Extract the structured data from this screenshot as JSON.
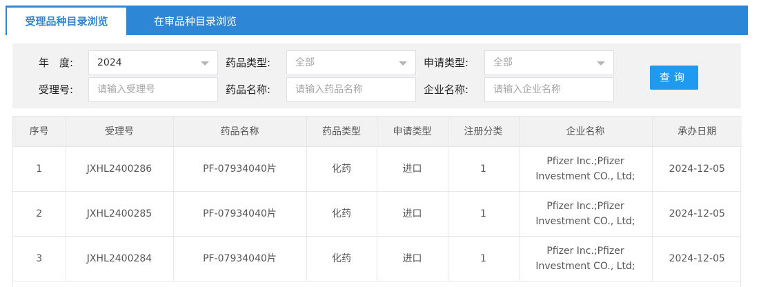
{
  "tabs": [
    {
      "label": "受理品种目录浏览",
      "active": true
    },
    {
      "label": "在审品种目录浏览",
      "active": false
    }
  ],
  "filters": {
    "year": {
      "label": "年　度:",
      "value": "2024"
    },
    "drug_type": {
      "label": "药品类型:",
      "value": "全部"
    },
    "apply_type": {
      "label": "申请类型:",
      "value": "全部"
    },
    "accept_no": {
      "label": "受理号:",
      "placeholder": "请输入受理号"
    },
    "drug_name": {
      "label": "药品名称:",
      "placeholder": "请输入药品名称"
    },
    "company_name": {
      "label": "企业名称:",
      "placeholder": "请输入企业名称"
    },
    "query_button": "查询"
  },
  "table": {
    "headers": [
      "序号",
      "受理号",
      "药品名称",
      "药品类型",
      "申请类型",
      "注册分类",
      "企业名称",
      "承办日期"
    ],
    "rows": [
      [
        "1",
        "JXHL2400286",
        "PF-07934040片",
        "化药",
        "进口",
        "1",
        "Pfizer Inc.;Pfizer Investment CO., Ltd;",
        "2024-12-05"
      ],
      [
        "2",
        "JXHL2400285",
        "PF-07934040片",
        "化药",
        "进口",
        "1",
        "Pfizer Inc.;Pfizer Investment CO., Ltd;",
        "2024-12-05"
      ],
      [
        "3",
        "JXHL2400284",
        "PF-07934040片",
        "化药",
        "进口",
        "1",
        "Pfizer Inc.;Pfizer Investment CO., Ltd;",
        "2024-12-05"
      ]
    ]
  },
  "colors": {
    "accent": "#2e86d6",
    "button": "#1e9bf0",
    "panel": "#f2f2f2"
  }
}
